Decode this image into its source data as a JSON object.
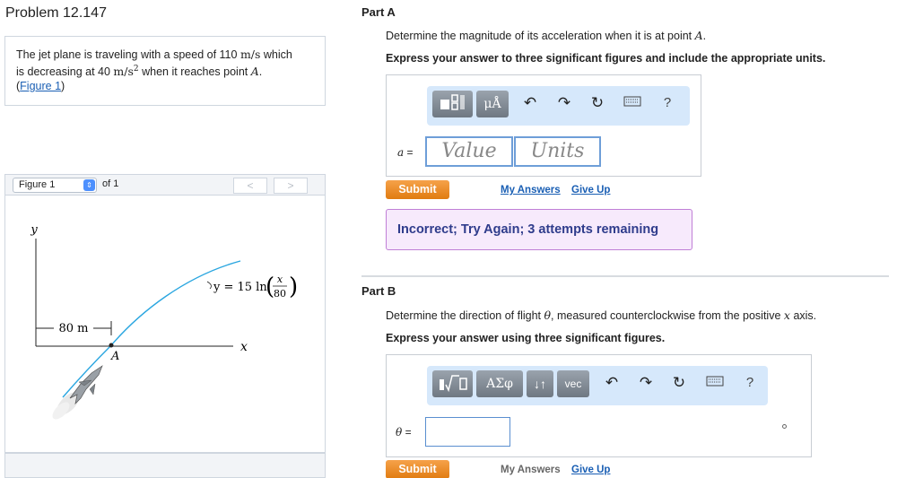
{
  "problem": {
    "title": "Problem 12.147",
    "statement_a": "The jet plane is traveling with a speed of 110",
    "speed_unit": "m/s",
    "statement_b": "which",
    "statement_c": "is decreasing at 40",
    "accel_unit": "m/s",
    "accel_exp": "2",
    "statement_d": "when it reaches point",
    "point": "A",
    "statement_end": ".",
    "figure_link": "Figure 1",
    "paren_open": "(",
    "paren_close": ")"
  },
  "figure": {
    "selected": "Figure 1",
    "of_text": "of 1",
    "prev_label": "<",
    "next_label": ">",
    "y_axis_label": "y",
    "x_axis_label": "x",
    "distance_label": "80 m",
    "point_label": "A",
    "eq_lhs": "y = 15 ln",
    "eq_num": "x",
    "eq_den": "80"
  },
  "partA": {
    "title": "Part A",
    "question_pre": "Determine the magnitude of its acceleration when it is at point",
    "question_point": "A",
    "question_post": ".",
    "instruction": "Express your answer to three significant figures and include the appropriate units.",
    "unit_btn": "μÅ",
    "help": "?",
    "var_label": "a",
    "equals": "=",
    "value_placeholder": "Value",
    "units_placeholder": "Units",
    "submit": "Submit",
    "my_answers": "My Answers",
    "give_up": "Give Up",
    "feedback": "Incorrect; Try Again; 3 attempts remaining",
    "feedback_color": "#2f3c8c"
  },
  "partB": {
    "title": "Part B",
    "question_pre": "Determine the direction of flight",
    "question_theta": "θ",
    "question_mid": ", measured counterclockwise from the positive",
    "question_x": "x",
    "question_post": "axis.",
    "instruction": "Express your answer using three significant figures.",
    "greek_btn": "ΑΣφ",
    "arrows_btn": "↓↑",
    "vec_btn": "vec",
    "help": "?",
    "var_label": "θ",
    "equals": "=",
    "submit": "Submit",
    "my_answers": "My Answers",
    "give_up": "Give Up"
  },
  "colors": {
    "accent": "#1a5fb4",
    "submit": "#e88a22",
    "toolbar_bg": "#d6e8fb",
    "curve": "#2aa6e0"
  },
  "icons": [
    "templates-icon",
    "undo-icon",
    "redo-icon",
    "reset-icon",
    "keyboard-icon",
    "help-icon",
    "jet-icon"
  ]
}
